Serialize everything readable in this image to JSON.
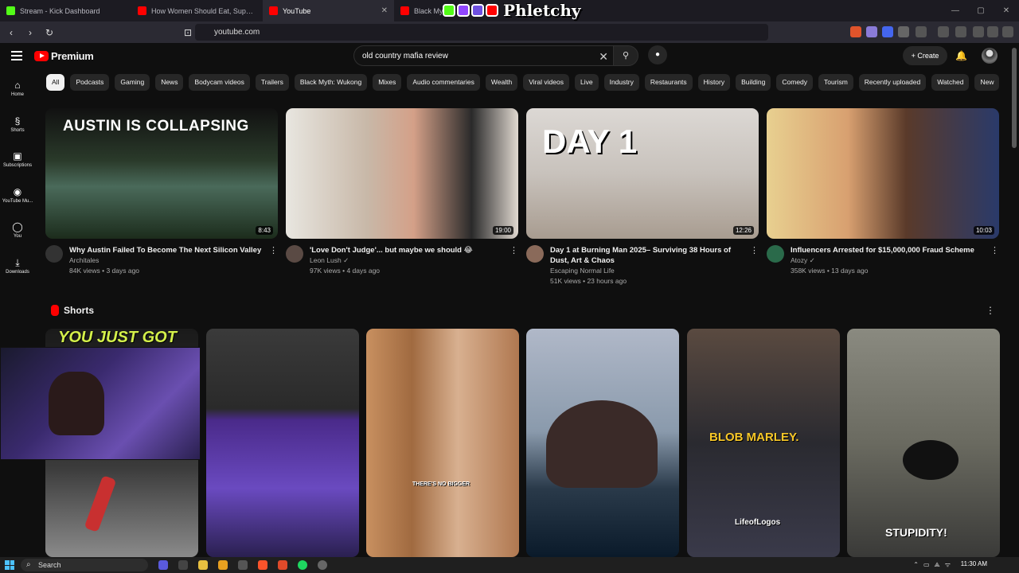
{
  "browser": {
    "tabs": [
      {
        "label": "Stream - Kick Dashboard",
        "color": "#53fc18",
        "active": false
      },
      {
        "label": "How Women Should Eat, Suppleme...",
        "color": "#ff0000",
        "active": false
      },
      {
        "label": "YouTube",
        "color": "#ff0000",
        "active": true
      },
      {
        "label": "Black Myth",
        "color": "#ff0000",
        "active": false
      }
    ],
    "url": "youtube.com",
    "overlay_logo_text": "Phletchy"
  },
  "youtube": {
    "brand": "Premium",
    "search_value": "old country mafia review",
    "create_label": "Create",
    "sidebar": [
      {
        "icon": "⌂",
        "label": "Home"
      },
      {
        "icon": "§",
        "label": "Shorts"
      },
      {
        "icon": "▣",
        "label": "Subscriptions"
      },
      {
        "icon": "◉",
        "label": "YouTube Mu..."
      },
      {
        "icon": "◯",
        "label": "You"
      },
      {
        "icon": "⤓",
        "label": "Downloads"
      }
    ],
    "chips": [
      "All",
      "Podcasts",
      "Gaming",
      "News",
      "Bodycam videos",
      "Trailers",
      "Black Myth: Wukong",
      "Mixes",
      "Audio commentaries",
      "Wealth",
      "Viral videos",
      "Live",
      "Industry",
      "Restaurants",
      "History",
      "Building",
      "Comedy",
      "Tourism",
      "Recently uploaded",
      "Watched",
      "New"
    ],
    "videos": [
      {
        "title": "Why Austin Failed To Become The Next Silicon Valley",
        "channel": "Architales",
        "stats": "84K views • 3 days ago",
        "duration": "8:43",
        "thumb_text": "AUSTIN IS COLLAPSING"
      },
      {
        "title": "'Love Don't Judge'... but maybe we should 😂",
        "channel": "Leon Lush ✓",
        "stats": "97K views • 4 days ago",
        "duration": "19:00",
        "thumb_text": ""
      },
      {
        "title": "Day 1 at Burning Man 2025– Surviving 38 Hours of Dust, Art & Chaos",
        "channel": "Escaping Normal Life",
        "stats": "51K views • 23 hours ago",
        "duration": "12:26",
        "thumb_text": "DAY 1"
      },
      {
        "title": "Influencers Arrested for $15,000,000 Fraud Scheme",
        "channel": "Atozy ✓",
        "stats": "358K views • 13 days ago",
        "duration": "10:03",
        "thumb_text": ""
      }
    ],
    "shorts_title": "Shorts",
    "shorts": [
      {
        "caption": "YOU JUST GOT"
      },
      {
        "caption": ""
      },
      {
        "caption": "THERE'S NO BIGGER"
      },
      {
        "caption": ""
      },
      {
        "caption": "BLOB MARLEY."
      },
      {
        "caption": "STUPIDITY!"
      }
    ],
    "shorts_extra_text": "LifeofLogos"
  },
  "taskbar": {
    "search_label": "Search",
    "clock": "11:30 AM"
  }
}
